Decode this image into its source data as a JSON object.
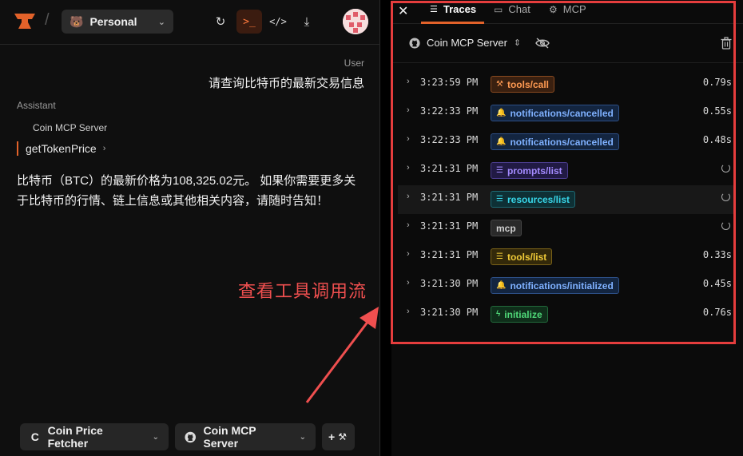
{
  "left": {
    "workspace_label": "Personal",
    "user_role": "User",
    "user_message": "请查询比特币的最新交易信息",
    "assistant_role": "Assistant",
    "server_name": "Coin MCP Server",
    "tool_name": "getTokenPrice",
    "answer": "比特币（BTC）的最新价格为108,325.02元。 如果你需要更多关于比特币的行情、链上信息或其他相关内容，请随时告知！",
    "annotation": "查看工具调用流",
    "bottom": {
      "agent_initial": "C",
      "agent_label": "Coin Price Fetcher",
      "server_label": "Coin MCP Server",
      "add_label": "+"
    }
  },
  "right": {
    "tabs": [
      {
        "label": "Traces",
        "icon": "list-icon"
      },
      {
        "label": "Chat",
        "icon": "chat-icon"
      },
      {
        "label": "MCP",
        "icon": "gear-icon"
      }
    ],
    "server_selector": "Coin MCP Server",
    "traces": [
      {
        "time": "3:23:59 PM",
        "label": "tools/call",
        "icon": "wrench-icon",
        "style": "b-orange",
        "duration": "0.79s",
        "pending": false
      },
      {
        "time": "3:22:33 PM",
        "label": "notifications/cancelled",
        "icon": "bell-icon",
        "style": "b-blue",
        "duration": "0.55s",
        "pending": false
      },
      {
        "time": "3:22:33 PM",
        "label": "notifications/cancelled",
        "icon": "bell-icon",
        "style": "b-blue",
        "duration": "0.48s",
        "pending": false
      },
      {
        "time": "3:21:31 PM",
        "label": "prompts/list",
        "icon": "list-icon",
        "style": "b-purple",
        "duration": "",
        "pending": true
      },
      {
        "time": "3:21:31 PM",
        "label": "resources/list",
        "icon": "list-icon",
        "style": "b-cyan",
        "duration": "",
        "pending": true
      },
      {
        "time": "3:21:31 PM",
        "label": "mcp",
        "icon": "",
        "style": "b-gray",
        "duration": "",
        "pending": true
      },
      {
        "time": "3:21:31 PM",
        "label": "tools/list",
        "icon": "list-icon",
        "style": "b-yellow",
        "duration": "0.33s",
        "pending": false
      },
      {
        "time": "3:21:30 PM",
        "label": "notifications/initialized",
        "icon": "bell-icon",
        "style": "b-blue",
        "duration": "0.45s",
        "pending": false
      },
      {
        "time": "3:21:30 PM",
        "label": "initialize",
        "icon": "bolt-icon",
        "style": "b-green",
        "duration": "0.76s",
        "pending": false
      }
    ]
  },
  "colors": {
    "accent": "#e2622a",
    "highlight": "#e53d3d"
  }
}
